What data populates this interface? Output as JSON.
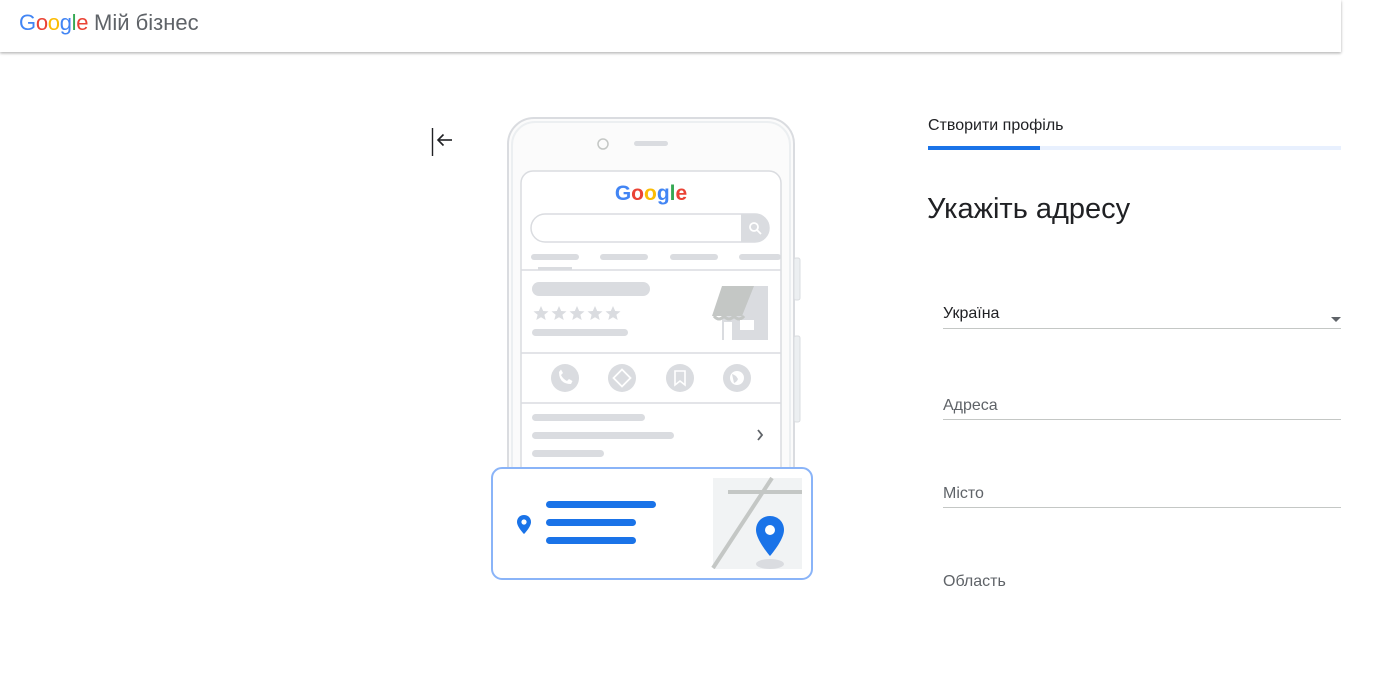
{
  "header": {
    "logo_letters": [
      {
        "ch": "G",
        "color": "#4285F4"
      },
      {
        "ch": "o",
        "color": "#EA4335"
      },
      {
        "ch": "o",
        "color": "#FBBC05"
      },
      {
        "ch": "g",
        "color": "#4285F4"
      },
      {
        "ch": "l",
        "color": "#34A853"
      },
      {
        "ch": "e",
        "color": "#EA4335"
      }
    ],
    "product_name": "Мій бізнес"
  },
  "illustration": {
    "phone_logo": "Google"
  },
  "progress": {
    "label": "Створити профіль",
    "value_percent": 27
  },
  "form": {
    "title": "Укажіть адресу",
    "country": {
      "value": "Україна"
    },
    "address": {
      "placeholder": "Адреса"
    },
    "city": {
      "placeholder": "Місто"
    },
    "region": {
      "placeholder": "Область"
    }
  },
  "colors": {
    "accent": "#1a73e8",
    "google_blue": "#4285F4",
    "google_red": "#EA4335",
    "google_yellow": "#FBBC05",
    "google_green": "#34A853"
  }
}
